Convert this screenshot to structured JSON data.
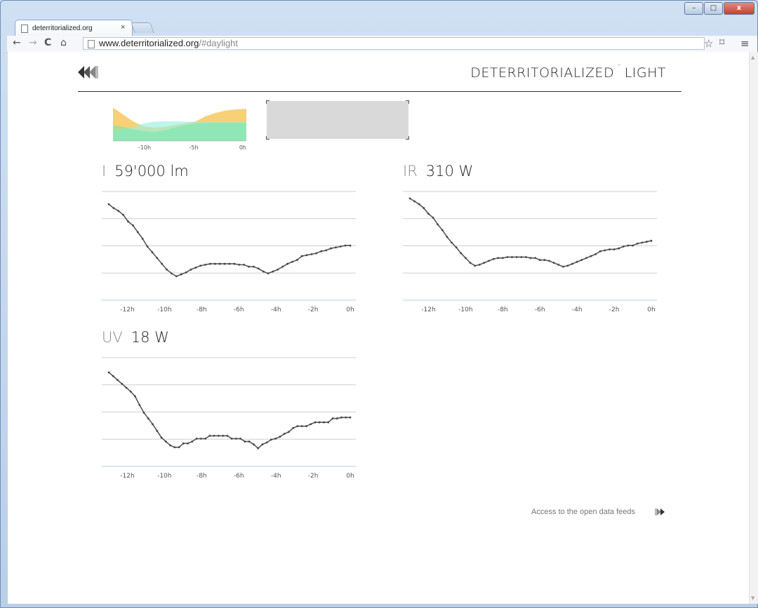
{
  "browser": {
    "tab_title": "deterritorialized.org",
    "tab_close": "×",
    "url_host": "www.deterritorialized.org",
    "url_path": "/#daylight",
    "window_controls": {
      "minimize": "–",
      "maximize": "□",
      "close": "x"
    }
  },
  "header": {
    "title_part1": "DETERRITORIALIZED",
    "title_sep": "¯",
    "title_part2": "LIGHT"
  },
  "colors": {
    "overview_yellow": "#f6c85f",
    "overview_green": "#7ae8b2",
    "overview_cyan": "#9af0e0",
    "line": "#555555",
    "grid": "#cfcfcf"
  },
  "overview": {
    "x_ticks": [
      "-10h",
      "-5h",
      "0h"
    ]
  },
  "footer": {
    "feeds_link": "Access to the open data feeds"
  },
  "chart_data": [
    {
      "type": "area",
      "x": [
        -13,
        -12,
        -11,
        -10,
        -9,
        -8,
        -7,
        -6,
        -5,
        -4,
        -3,
        -2,
        -1,
        0
      ],
      "x_ticks": [
        "-10h",
        "-5h",
        "0h"
      ],
      "series": [
        {
          "values": [
            0.95,
            0.75,
            0.55,
            0.42,
            0.38,
            0.4,
            0.45,
            0.5,
            0.55,
            0.7,
            0.8,
            0.87,
            0.9,
            0.92
          ]
        },
        {
          "values": [
            0.25,
            0.32,
            0.4,
            0.5,
            0.55,
            0.56,
            0.56,
            0.55,
            0.55,
            0.55,
            0.55,
            0.55,
            0.55,
            0.55
          ]
        },
        {
          "values": [
            0.45,
            0.4,
            0.33,
            0.28,
            0.25,
            0.3,
            0.38,
            0.45,
            0.5,
            0.52,
            0.52,
            0.52,
            0.52,
            0.52
          ]
        }
      ]
    },
    {
      "type": "line",
      "label": "I",
      "value_text": "59'000 lm",
      "x_ticks": [
        "-12h",
        "-10h",
        "-8h",
        "-6h",
        "-4h",
        "-2h",
        "0h"
      ],
      "xlim": [
        -13,
        0
      ],
      "ylim": [
        0,
        100
      ],
      "grid": true,
      "values": [
        94,
        90,
        87,
        83,
        76,
        72,
        65,
        58,
        50,
        44,
        38,
        32,
        26,
        22,
        19,
        21,
        23,
        26,
        28,
        30,
        31,
        32,
        32,
        32,
        32,
        32,
        32,
        31,
        31,
        29,
        29,
        27,
        24,
        22,
        24,
        26,
        29,
        32,
        34,
        36,
        40,
        41,
        42,
        43,
        45,
        46,
        48,
        49,
        50,
        51,
        51
      ]
    },
    {
      "type": "line",
      "label": "IR",
      "value_text": "310 W",
      "x_ticks": [
        "-12h",
        "-10h",
        "-8h",
        "-6h",
        "-4h",
        "-2h",
        "0h"
      ],
      "xlim": [
        -13,
        0
      ],
      "ylim": [
        0,
        100
      ],
      "grid": true,
      "values": [
        100,
        97,
        94,
        90,
        84,
        80,
        73,
        67,
        60,
        54,
        49,
        43,
        38,
        33,
        30,
        31,
        33,
        35,
        37,
        38,
        38,
        39,
        39,
        39,
        39,
        39,
        38,
        38,
        36,
        36,
        35,
        33,
        31,
        29,
        30,
        32,
        34,
        36,
        38,
        40,
        42,
        45,
        46,
        47,
        47,
        48,
        50,
        51,
        51,
        53,
        54,
        55,
        56
      ]
    },
    {
      "type": "line",
      "label": "UV",
      "value_text": "18 W",
      "x_ticks": [
        "-12h",
        "-10h",
        "-8h",
        "-6h",
        "-4h",
        "-2h",
        "0h"
      ],
      "xlim": [
        -13,
        0
      ],
      "ylim": [
        0,
        100
      ],
      "grid": true,
      "values": [
        92,
        88,
        84,
        80,
        76,
        72,
        67,
        58,
        50,
        44,
        38,
        31,
        24,
        20,
        16,
        14,
        14,
        18,
        18,
        20,
        23,
        23,
        23,
        26,
        26,
        26,
        26,
        26,
        23,
        23,
        23,
        20,
        20,
        17,
        13,
        17,
        19,
        22,
        23,
        25,
        28,
        30,
        34,
        36,
        36,
        36,
        38,
        40,
        40,
        40,
        40,
        44,
        44,
        45,
        45,
        45
      ]
    }
  ]
}
